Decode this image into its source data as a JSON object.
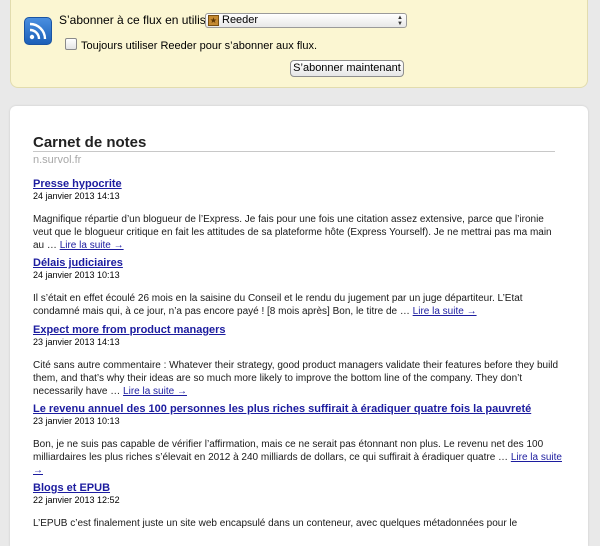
{
  "subscribe": {
    "label": "S’abonner à ce flux en utilisant",
    "selected_app": "Reeder",
    "app_icon": "reeder-star-icon",
    "always_label": "Toujours utiliser Reeder pour s’abonner aux flux.",
    "always_checked": false,
    "button_label": "S’abonner maintenant"
  },
  "feed": {
    "title": "Carnet de notes",
    "url": "n.survol.fr",
    "entries": [
      {
        "title": "Presse hypocrite",
        "date": "24 janvier 2013 14:13",
        "summary": "Magnifique répartie d’un blogueur de l’Express. Je fais pour une fois une citation assez extensive, parce que l’ironie veut que le blogueur critique en fait les attitudes de sa plateforme hôte (Express Yourself). Je ne mettrai pas ma main au …",
        "more": "Lire la suite →"
      },
      {
        "title": "Délais judiciaires",
        "date": "24 janvier 2013 10:13",
        "summary": "Il s’était en effet écoulé 26 mois en la saisine du Conseil et le rendu du jugement par un juge départiteur. L’Etat condamné mais qui, à ce jour, n’a pas encore payé ! [8 mois après] Bon, le titre de …",
        "more": "Lire la suite →"
      },
      {
        "title": "Expect more from product managers",
        "date": "23 janvier 2013 14:13",
        "summary": "Cité sans autre commentaire : Whatever their strategy, good product managers validate their features before they build them, and that’s why their ideas are so much more likely to improve the bottom line of the company. They don’t necessarily have …",
        "more": "Lire la suite →"
      },
      {
        "title": "Le revenu annuel des 100 personnes les plus riches suffirait à éradiquer quatre fois la pauvreté",
        "date": "23 janvier 2013 10:13",
        "summary": "Bon, je ne suis pas capable de vérifier l’affirmation, mais ce ne serait pas étonnant non plus. Le revenu net des 100 milliardaires les plus riches s’élevait en 2012 à 240 milliards de dollars, ce qui suffirait à éradiquer quatre …",
        "more": "Lire la suite →"
      },
      {
        "title": "Blogs et EPUB",
        "date": "22 janvier 2013 12:52",
        "summary": "L’EPUB c’est finalement juste un site web encapsulé dans un conteneur, avec quelques métadonnées pour le",
        "more": ""
      }
    ]
  }
}
